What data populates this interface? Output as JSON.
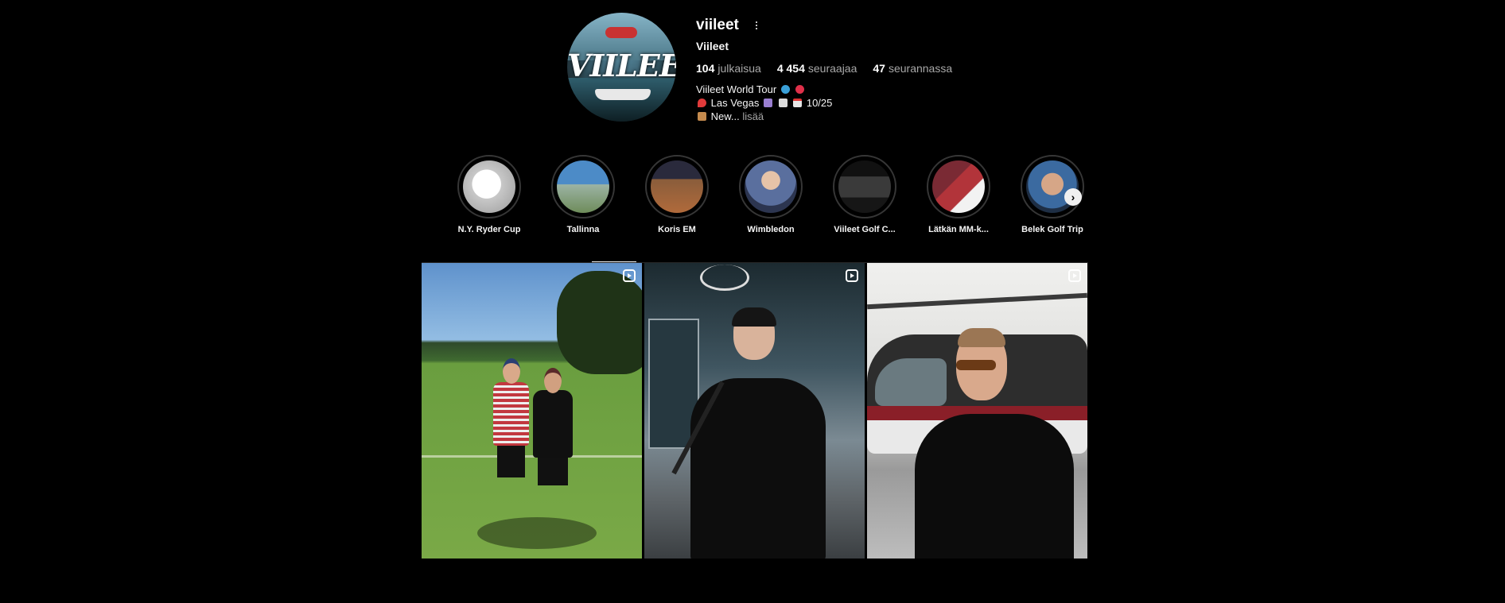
{
  "profile": {
    "username": "viileet",
    "full_name": "Viileet",
    "avatar_text": "VIILEET",
    "stats": [
      {
        "count": "104",
        "label": "julkaisua"
      },
      {
        "count": "4 454",
        "label": "seuraajaa"
      },
      {
        "count": "47",
        "label": "seurannassa"
      }
    ],
    "bio": {
      "line1": "Viileet World Tour",
      "line2_prefix": "Las Vegas",
      "line2_suffix": "10/25",
      "line3": "New...",
      "more_label": "lisää"
    }
  },
  "highlights": [
    {
      "label": "N.Y. Ryder Cup",
      "color": "#d7d7d7"
    },
    {
      "label": "Tallinna",
      "color": "#4c8bc7"
    },
    {
      "label": "Koris EM",
      "color": "#b06a3b"
    },
    {
      "label": "Wimbledon",
      "color": "#5a6f9e"
    },
    {
      "label": "Viileet Golf C...",
      "color": "#3a3a3a"
    },
    {
      "label": "Lätkän MM-k...",
      "color": "#b2343a"
    },
    {
      "label": "Belek Golf Trip",
      "color": "#3b6aa0"
    }
  ],
  "icons": {
    "more": "more-options-icon",
    "next": "chevron-right-icon",
    "reel": "reel-icon"
  },
  "colors": {
    "background": "#000000",
    "text": "#f5f5f5",
    "secondary_text": "#a8a8a8"
  }
}
